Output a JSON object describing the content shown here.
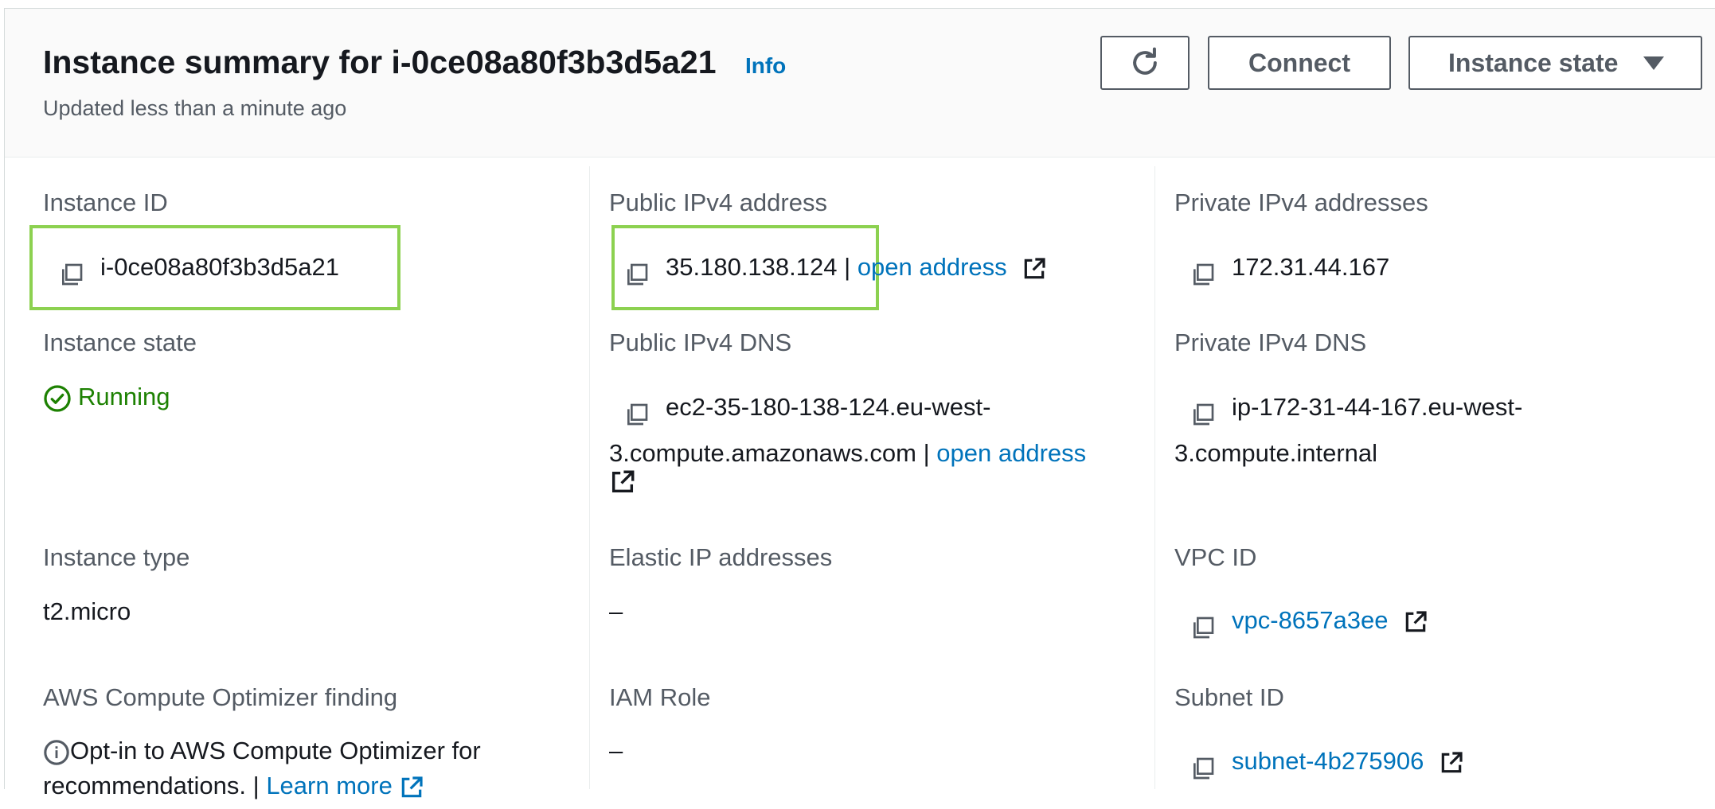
{
  "header": {
    "title": "Instance summary for i-0ce08a80f3b3d5a21",
    "info": "Info",
    "subtitle": "Updated less than a minute ago",
    "connect_label": "Connect",
    "instance_state_label": "Instance state"
  },
  "col1": {
    "instance_id_label": "Instance ID",
    "instance_id": "i-0ce08a80f3b3d5a21",
    "instance_state_label": "Instance state",
    "instance_state": "Running",
    "instance_type_label": "Instance type",
    "instance_type": "t2.micro",
    "optimizer_label": "AWS Compute Optimizer finding",
    "optimizer_text": "Opt-in to AWS Compute Optimizer for",
    "optimizer_text2": "recommendations. |",
    "learn_more": "Learn more"
  },
  "col2": {
    "public_ipv4_label": "Public IPv4 address",
    "public_ipv4": "35.180.138.124",
    "sep": "|",
    "open_address": "open address",
    "public_dns_label": "Public IPv4 DNS",
    "public_dns_line1": "ec2-35-180-138-124.eu-west-",
    "public_dns_line2": "3.compute.amazonaws.com",
    "elastic_ip_label": "Elastic IP addresses",
    "elastic_ip": "–",
    "iam_role_label": "IAM Role",
    "iam_role": "–"
  },
  "col3": {
    "private_ipv4_label": "Private IPv4 addresses",
    "private_ipv4": "172.31.44.167",
    "private_dns_label": "Private IPv4 DNS",
    "private_dns_line1": "ip-172-31-44-167.eu-west-",
    "private_dns_line2": "3.compute.internal",
    "vpc_label": "VPC ID",
    "vpc_id": "vpc-8657a3ee",
    "subnet_label": "Subnet ID",
    "subnet_id": "subnet-4b275906"
  },
  "icons": {
    "copy": "copy-icon",
    "external": "external-link-icon",
    "refresh": "refresh-icon",
    "status_ok": "check-circle-icon",
    "info": "info-circle-icon"
  },
  "colors": {
    "link": "#0073bb",
    "running": "#1d8102",
    "highlight": "#8cd150",
    "text": "#16191f",
    "label": "#545b64"
  }
}
